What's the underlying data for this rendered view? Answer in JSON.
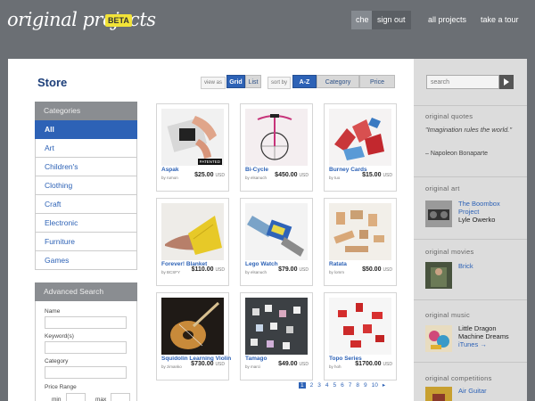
{
  "header": {
    "logo": "original projects",
    "badge": "BETA",
    "user": "che",
    "signout": "sign out",
    "links": [
      "all projects",
      "take a tour"
    ]
  },
  "store": {
    "title": "Store",
    "view_label": "view as",
    "view_options": [
      "Grid",
      "List"
    ],
    "view_selected": "Grid",
    "sort_label": "sort by",
    "sort_options": [
      "A-Z",
      "Category",
      "Price"
    ],
    "sort_selected": "A-Z"
  },
  "sidebar": {
    "categories_header": "Categories",
    "categories": [
      "All",
      "Art",
      "Children's",
      "Clothing",
      "Craft",
      "Electronic",
      "Furniture",
      "Games"
    ],
    "selected": "All",
    "advanced_header": "Advanced Search",
    "fields": [
      "Name",
      "Keyword(s)",
      "Category",
      "Price Range"
    ],
    "price_min": "min",
    "price_max": "max"
  },
  "products": [
    {
      "name": "Aspak",
      "by": "by rumon",
      "price": "$25.00",
      "currency": "USD",
      "badge": "PATENTED"
    },
    {
      "name": "Bi-Cycle",
      "by": "by elsanuch",
      "price": "$450.00",
      "currency": "USD"
    },
    {
      "name": "Burney Cards",
      "by": "by tuo",
      "price": "$15.00",
      "currency": "USD"
    },
    {
      "name": "Forever! Blanket",
      "by": "by BCSFY",
      "price": "$110.00",
      "currency": "USD"
    },
    {
      "name": "Lego Watch",
      "by": "by elsanuch",
      "price": "$79.00",
      "currency": "USD"
    },
    {
      "name": "Ratata",
      "by": "by lomm",
      "price": "$50.00",
      "currency": "USD"
    },
    {
      "name": "Squidolin Learning Violin",
      "by": "by zimanko",
      "price": "$730.00",
      "currency": "USD"
    },
    {
      "name": "Tamago",
      "by": "by marci",
      "price": "$49.00",
      "currency": "USD"
    },
    {
      "name": "Topo Series",
      "by": "by hoh",
      "price": "$1700.00",
      "currency": "USD"
    }
  ],
  "pagination": {
    "pages": [
      "1",
      "2",
      "3",
      "4",
      "5",
      "6",
      "7",
      "8",
      "9",
      "10",
      "▸"
    ],
    "current": "1"
  },
  "right": {
    "search_placeholder": "search",
    "quotes_header": "original quotes",
    "quote": "\"Imagination rules the world.\"",
    "quote_author": "– Napoleon Bonaparte",
    "art_header": "original art",
    "art_title": "The Boombox Project",
    "art_author": "Lyle Owerko",
    "movies_header": "original movies",
    "movie_title": "Brick",
    "music_header": "original music",
    "music_artist": "Little Dragon",
    "music_album": "Machine Dreams",
    "music_link": "iTunes →",
    "competitions_header": "original competitions",
    "competition_title": "Air Guitar"
  },
  "colors": {
    "accent": "#2d62b6",
    "header_bg": "#6b6f74",
    "beta": "#f2e338"
  }
}
